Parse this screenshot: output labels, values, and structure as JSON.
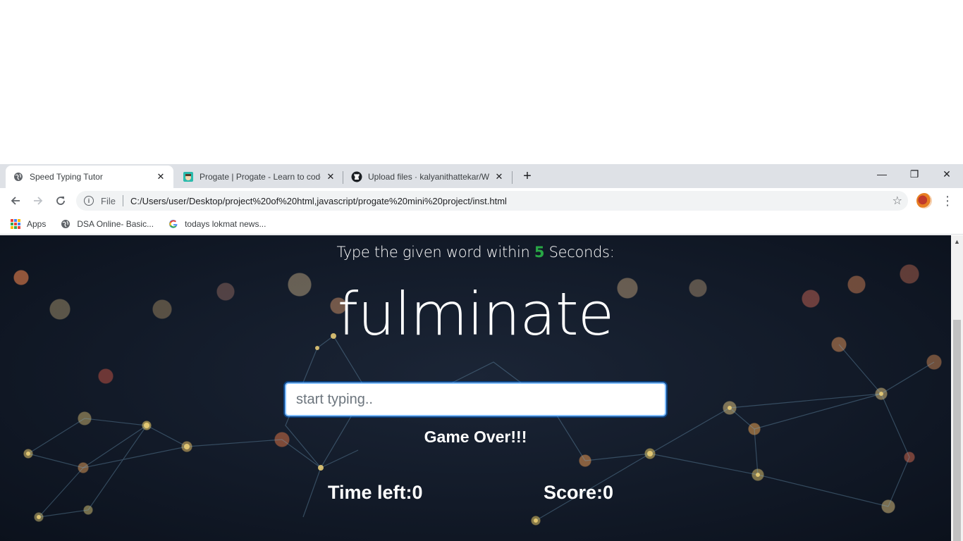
{
  "browser": {
    "tabs": [
      {
        "title": "Speed Typing Tutor",
        "active": true,
        "icon": "globe-icon"
      },
      {
        "title": "Progate | Progate - Learn to code",
        "active": false,
        "icon": "progate-icon"
      },
      {
        "title": "Upload files · kalyanithattekar/W",
        "active": false,
        "icon": "github-icon"
      }
    ],
    "new_tab": "+",
    "window_controls": {
      "minimize": "—",
      "restore": "❐",
      "close": "✕"
    },
    "address_bar": {
      "scheme": "File",
      "url": "C:/Users/user/Desktop/project%20of%20html,javascript/progate%20mini%20project/inst.html"
    },
    "bookmarks": [
      {
        "label": "Apps",
        "icon": "apps-grid-icon"
      },
      {
        "label": "DSA Online- Basic...",
        "icon": "globe-icon"
      },
      {
        "label": "todays lokmat news...",
        "icon": "google-icon"
      }
    ]
  },
  "game": {
    "instruction_before": "Type the given word within ",
    "seconds": "5",
    "instruction_after": " Seconds:",
    "current_word": "fulminate",
    "input": {
      "value": "",
      "placeholder": "start typing.."
    },
    "message": "Game Over!!!",
    "time_left_label": "Time left:",
    "time_left": "0",
    "score_label": "Score:",
    "score": "0"
  },
  "colors": {
    "seconds_highlight": "#28a745",
    "background_dark": "#121a28",
    "input_focus_border": "#80bdff"
  }
}
